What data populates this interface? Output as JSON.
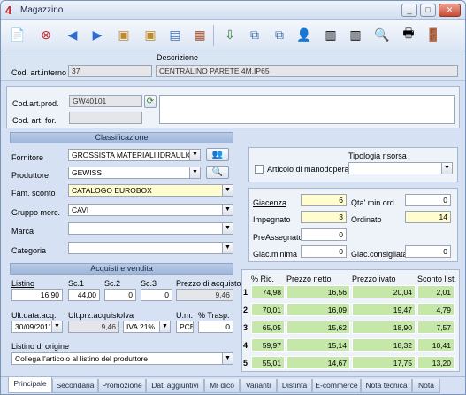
{
  "window": {
    "title": "Magazzino",
    "icon": "4"
  },
  "toolbar": {
    "icons": [
      "new-doc-icon",
      "delete-icon",
      "prev-icon",
      "next-icon",
      "add-box-icon",
      "add-box2-icon",
      "image-icon",
      "photo-icon",
      "export-icon",
      "copy-icon",
      "copy2-icon",
      "user-icon",
      "barcode-icon",
      "barcode2-icon",
      "tag-icon",
      "search-icon",
      "print-icon",
      "exit-icon"
    ]
  },
  "header": {
    "code_label": "Cod. art.interno",
    "code_value": "37",
    "desc_label": "Descrizione",
    "desc_value": "CENTRALINO PARETE 4M.IP65"
  },
  "codes": {
    "prod_label": "Cod.art.prod.",
    "prod_value": "GW40101",
    "for_label": "Cod. art. for."
  },
  "classificazione": {
    "title": "Classificazione",
    "fornitore_label": "Fornitore",
    "fornitore_value": "GROSSISTA MATERIALI IDRAULICI",
    "produttore_label": "Produttore",
    "produttore_value": "GEWISS",
    "fam_label": "Fam. sconto",
    "fam_value": "CATALOGO EUROBOX",
    "gruppo_label": "Gruppo merc.",
    "gruppo_value": "CAVI",
    "marca_label": "Marca",
    "marca_value": "",
    "categoria_label": "Categoria",
    "categoria_value": ""
  },
  "risorsa": {
    "title": "Tipologia risorsa",
    "manodopera_label": "Articolo di manodopera"
  },
  "stock": {
    "giacenza_label": "Giacenza",
    "giacenza": "6",
    "qta_label": "Qta' min.ord.",
    "qta": "0",
    "impegnato_label": "Impegnato",
    "impegnato": "3",
    "ordinato_label": "Ordinato",
    "ordinato": "14",
    "preass_label": "PreAssegnato",
    "preass": "0",
    "giacmin_label": "Giac.minima",
    "giacmin": "0",
    "giaccons_label": "Giac.consigliata",
    "giaccons": "0"
  },
  "acquisti": {
    "title": "Acquisti e vendita",
    "listino_label": "Listino",
    "listino": "16,90",
    "sc1_label": "Sc.1",
    "sc1": "44,00",
    "sc2_label": "Sc.2",
    "sc2": "0",
    "sc3_label": "Sc.3",
    "sc3": "0",
    "prezzo_label": "Prezzo di acquisto",
    "prezzo": "9,46",
    "ultdata_label": "Ult.data.acq.",
    "ultdata": "30/09/2011",
    "ultprz_label": "Ult.prz.acquisto",
    "ultprz": "9,46",
    "iva_label": "Iva",
    "iva": "IVA 21%",
    "um_label": "U.m.",
    "um": "PCE",
    "trasp_label": "% Trasp.",
    "trasp": "0",
    "origine_label": "Listino di origine",
    "origine_value": "Collega l'articolo al listino del produttore"
  },
  "prices": {
    "headers": [
      "% Ric.",
      "Prezzo netto",
      "Prezzo ivato",
      "Sconto list."
    ],
    "rows": [
      {
        "n": "1",
        "ric": "74,98",
        "netto": "16,56",
        "ivato": "20,04",
        "sconto": "2,01"
      },
      {
        "n": "2",
        "ric": "70,01",
        "netto": "16,09",
        "ivato": "19,47",
        "sconto": "4,79"
      },
      {
        "n": "3",
        "ric": "65,05",
        "netto": "15,62",
        "ivato": "18,90",
        "sconto": "7,57"
      },
      {
        "n": "4",
        "ric": "59,97",
        "netto": "15,14",
        "ivato": "18,32",
        "sconto": "10,41"
      },
      {
        "n": "5",
        "ric": "55,01",
        "netto": "14,67",
        "ivato": "17,75",
        "sconto": "13,20"
      }
    ]
  },
  "tabs": [
    "Principale",
    "Secondaria",
    "Promozione",
    "Dati aggiuntivi",
    "Mr dico",
    "Varianti",
    "Distinta",
    "E-commerce",
    "Nota tecnica",
    "Nota"
  ]
}
